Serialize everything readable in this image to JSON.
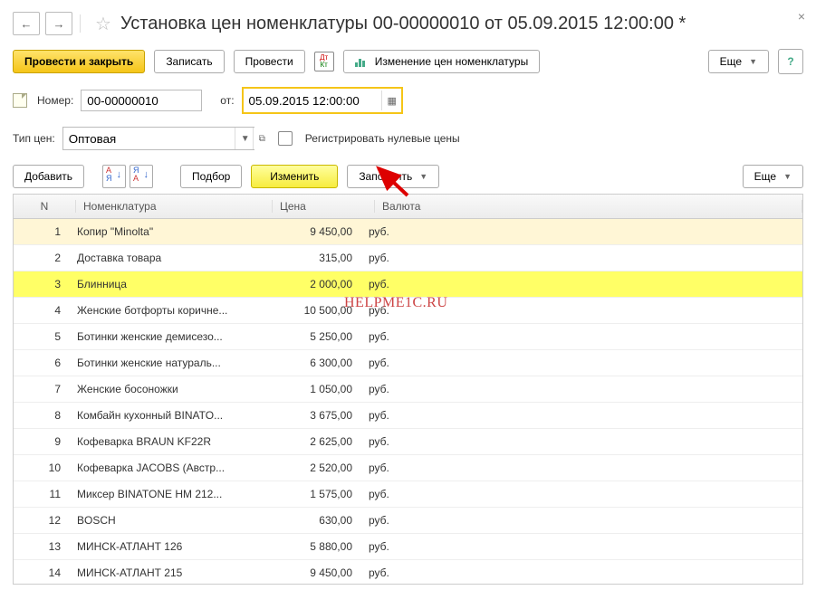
{
  "title": "Установка цен номенклатуры 00-00000010 от 05.09.2015 12:00:00 *",
  "toolbar": {
    "post_close": "Провести и закрыть",
    "save": "Записать",
    "post": "Провести",
    "price_changes": "Изменение цен номенклатуры",
    "more": "Еще"
  },
  "fields": {
    "number_label": "Номер:",
    "number_value": "00-00000010",
    "from_label": "от:",
    "date_value": "05.09.2015 12:00:00",
    "price_type_label": "Тип цен:",
    "price_type_value": "Оптовая",
    "reg_zero_label": "Регистрировать нулевые цены"
  },
  "tabletools": {
    "add": "Добавить",
    "pick": "Подбор",
    "change": "Изменить",
    "fill": "Заполнить",
    "more": "Еще"
  },
  "columns": {
    "n": "N",
    "name": "Номенклатура",
    "price": "Цена",
    "currency": "Валюта"
  },
  "rows": [
    {
      "n": "1",
      "name": "Копир \"Minolta\"",
      "price": "9 450,00",
      "cur": "руб.",
      "sel": true
    },
    {
      "n": "2",
      "name": "Доставка товара",
      "price": "315,00",
      "cur": "руб."
    },
    {
      "n": "3",
      "name": "Блинница",
      "price": "2 000,00",
      "cur": "руб.",
      "hl": true
    },
    {
      "n": "4",
      "name": "Женские ботфорты коричне...",
      "price": "10 500,00",
      "cur": "руб."
    },
    {
      "n": "5",
      "name": "Ботинки женские демисезо...",
      "price": "5 250,00",
      "cur": "руб."
    },
    {
      "n": "6",
      "name": "Ботинки женские натураль...",
      "price": "6 300,00",
      "cur": "руб."
    },
    {
      "n": "7",
      "name": "Женские босоножки",
      "price": "1 050,00",
      "cur": "руб."
    },
    {
      "n": "8",
      "name": "Комбайн кухонный BINATO...",
      "price": "3 675,00",
      "cur": "руб."
    },
    {
      "n": "9",
      "name": "Кофеварка BRAUN KF22R",
      "price": "2 625,00",
      "cur": "руб."
    },
    {
      "n": "10",
      "name": "Кофеварка JACOBS (Австр...",
      "price": "2 520,00",
      "cur": "руб."
    },
    {
      "n": "11",
      "name": "Миксер BINATONE HM 212...",
      "price": "1 575,00",
      "cur": "руб."
    },
    {
      "n": "12",
      "name": "BOSCH",
      "price": "630,00",
      "cur": "руб."
    },
    {
      "n": "13",
      "name": "МИНСК-АТЛАНТ 126",
      "price": "5 880,00",
      "cur": "руб."
    },
    {
      "n": "14",
      "name": "МИНСК-АТЛАНТ 215",
      "price": "9 450,00",
      "cur": "руб."
    }
  ],
  "watermark": "HELPME1C.RU"
}
